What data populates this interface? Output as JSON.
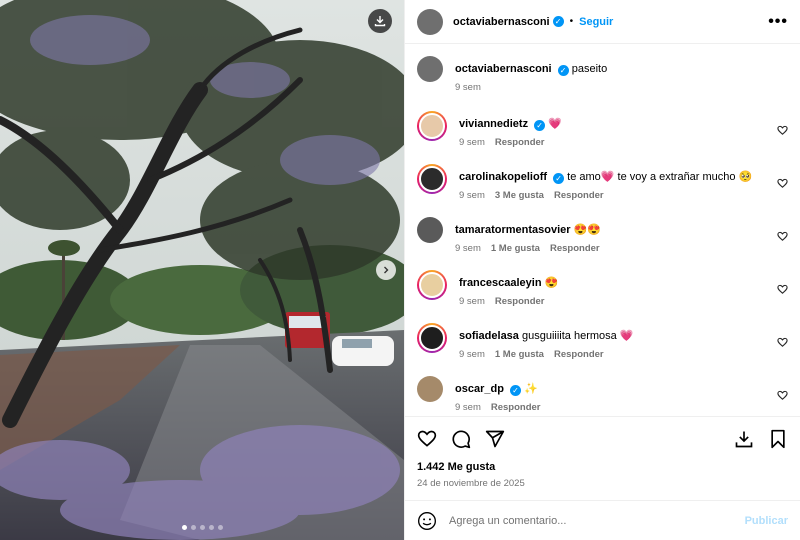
{
  "post": {
    "author": "octaviabernasconi",
    "follow_label": "Seguir",
    "separator": "•",
    "more_label": "•••",
    "caption": {
      "user": "octaviabernasconi",
      "text": "paseito",
      "time": "9 sem"
    },
    "likes": "1.442 Me gusta",
    "date": "24 de noviembre de 2025"
  },
  "comments": [
    {
      "user": "viviannedietz",
      "verified": true,
      "text": "💗",
      "time": "9 sem",
      "likes": "",
      "reply": "Responder",
      "avatar_color": "#e7c9a9",
      "ring": true
    },
    {
      "user": "carolinakopelioff",
      "verified": true,
      "text": "te amo💗 te voy a extrañar mucho 🥺",
      "time": "9 sem",
      "likes": "3 Me gusta",
      "reply": "Responder",
      "avatar_color": "#2b2b2b",
      "ring": true
    },
    {
      "user": "tamaratormentasovier",
      "verified": false,
      "text": "😍😍",
      "time": "9 sem",
      "likes": "1 Me gusta",
      "reply": "Responder",
      "avatar_color": "#5a5a5a",
      "ring": false
    },
    {
      "user": "francescaaleyin",
      "verified": false,
      "text": "😍",
      "time": "9 sem",
      "likes": "",
      "reply": "Responder",
      "avatar_color": "#e8cfa0",
      "ring": true
    },
    {
      "user": "sofiadelasa",
      "verified": false,
      "text": "gusguiiiita hermosa 💗",
      "time": "9 sem",
      "likes": "1 Me gusta",
      "reply": "Responder",
      "avatar_color": "#1e1e1e",
      "ring": true
    },
    {
      "user": "oscar_dp",
      "verified": true,
      "text": "✨",
      "time": "9 sem",
      "likes": "",
      "reply": "Responder",
      "avatar_color": "#a58a6a",
      "ring": false
    }
  ],
  "composer": {
    "placeholder": "Agrega un comentario...",
    "publish_label": "Publicar"
  },
  "icons": {
    "like": "heart-icon",
    "comment": "comment-icon",
    "share": "share-icon",
    "download": "download-icon",
    "save": "bookmark-icon",
    "emoji": "emoji-icon",
    "next": "chevron-right-icon"
  },
  "carousel": {
    "count": 5,
    "active": 0
  },
  "colors": {
    "accent": "#0095f6",
    "muted": "#737373",
    "publish_disabled": "#b2dffc"
  }
}
